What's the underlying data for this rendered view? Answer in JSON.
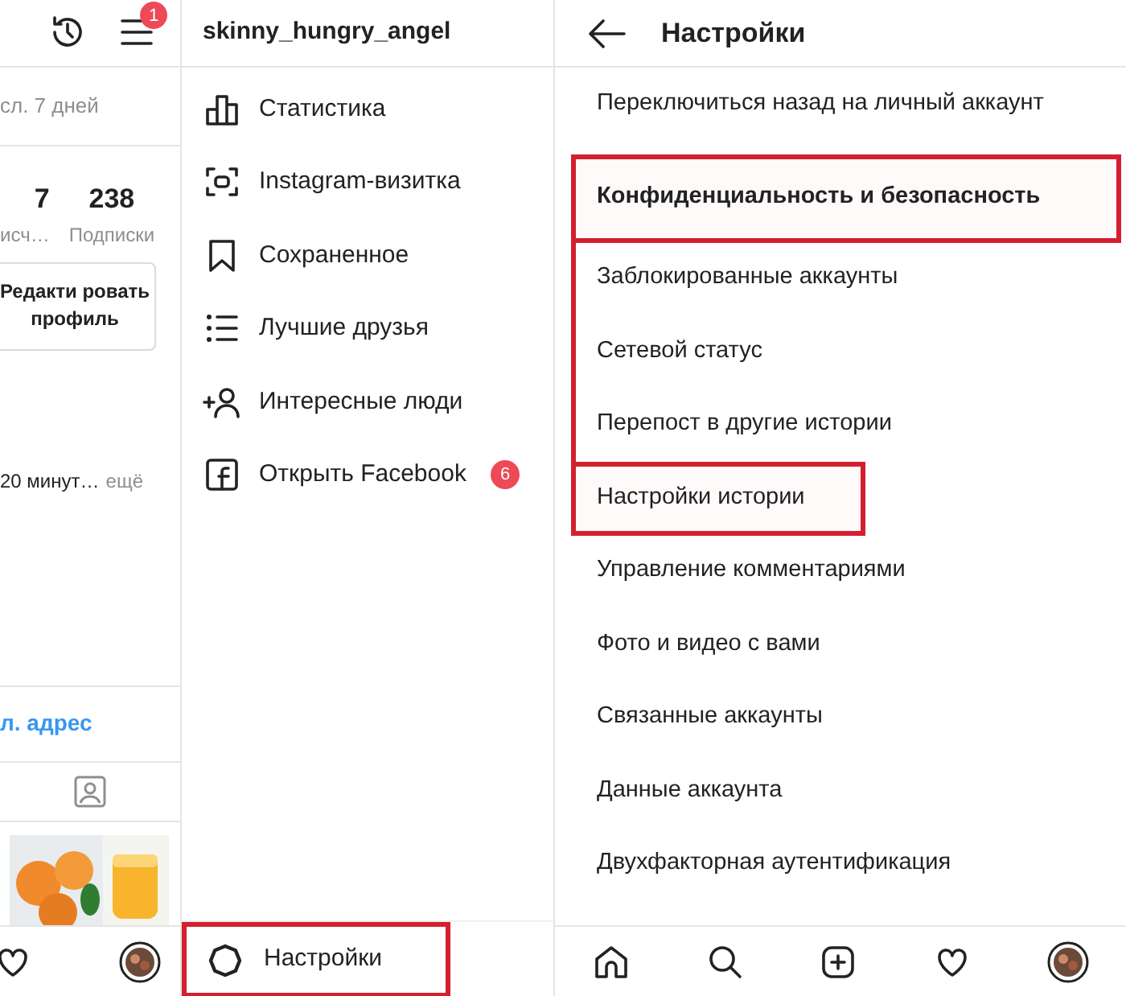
{
  "profile_panel": {
    "notification_count": "1",
    "period": "сл. 7 дней",
    "stats": [
      {
        "value": "7",
        "label": "исч…"
      },
      {
        "value": "238",
        "label": "Подписки"
      }
    ],
    "edit_button": "Редакти ровать профиль",
    "bio": "20 минут…",
    "more": "ещё",
    "email_link": "л. адрес"
  },
  "menu_panel": {
    "username": "skinny_hungry_angel",
    "items": [
      {
        "kind": "stats",
        "label": "Статистика"
      },
      {
        "kind": "nametag",
        "label": "Instagram-визитка"
      },
      {
        "kind": "saved",
        "label": "Сохраненное"
      },
      {
        "kind": "close_friends",
        "label": "Лучшие друзья"
      },
      {
        "kind": "discover",
        "label": "Интересные люди"
      },
      {
        "kind": "facebook",
        "label": "Открыть Facebook",
        "badge": "6"
      }
    ],
    "settings": {
      "label": "Настройки",
      "highlighted": true
    }
  },
  "settings_panel": {
    "title": "Настройки",
    "items": [
      {
        "label": "Переключиться назад на личный аккаунт",
        "bold": false,
        "highlighted": false,
        "bracketed": false
      },
      {
        "label": "Конфиденциальность и безопасность",
        "bold": true,
        "highlighted": true,
        "bracketed": false
      },
      {
        "label": "Заблокированные аккаунты",
        "bold": false,
        "highlighted": false,
        "bracketed": true
      },
      {
        "label": "Сетевой статус",
        "bold": false,
        "highlighted": false,
        "bracketed": true
      },
      {
        "label": "Перепост в другие истории",
        "bold": false,
        "highlighted": false,
        "bracketed": true
      },
      {
        "label": "Настройки истории",
        "bold": false,
        "highlighted": true,
        "bracketed": false
      },
      {
        "label": "Управление комментариями",
        "bold": false,
        "highlighted": false,
        "bracketed": false
      },
      {
        "label": "Фото и видео с вами",
        "bold": false,
        "highlighted": false,
        "bracketed": false
      },
      {
        "label": "Связанные аккаунты",
        "bold": false,
        "highlighted": false,
        "bracketed": false
      },
      {
        "label": "Данные аккаунта",
        "bold": false,
        "highlighted": false,
        "bracketed": false
      },
      {
        "label": "Двухфакторная аутентификация",
        "bold": false,
        "highlighted": false,
        "bracketed": false
      }
    ]
  }
}
